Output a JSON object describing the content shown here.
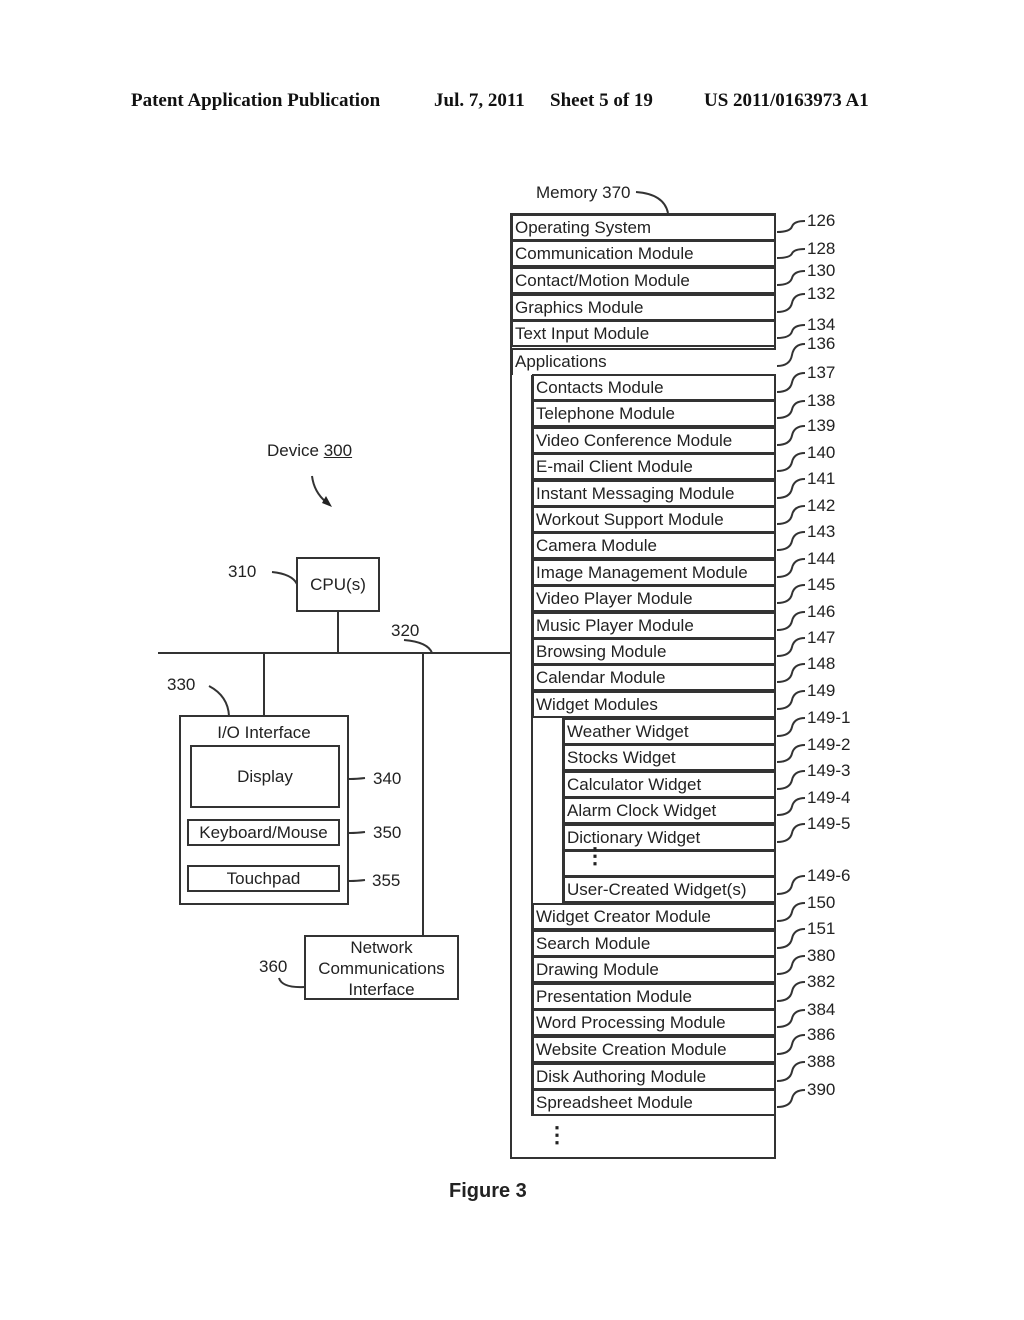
{
  "header": {
    "publication": "Patent Application Publication",
    "date": "Jul. 7, 2011",
    "sheet": "Sheet 5 of 19",
    "number": "US 2011/0163973 A1"
  },
  "device": {
    "label": "Device",
    "ref": "300"
  },
  "cpu": {
    "label": "CPU(s)",
    "ref": "310"
  },
  "bus": {
    "ref": "320"
  },
  "io": {
    "label": "I/O Interface",
    "ref": "330",
    "display": {
      "label": "Display",
      "ref": "340"
    },
    "keyboard": {
      "label": "Keyboard/Mouse",
      "ref": "350"
    },
    "touchpad": {
      "label": "Touchpad",
      "ref": "355"
    }
  },
  "network": {
    "line1": "Network",
    "line2": "Communications",
    "line3": "Interface",
    "ref": "360"
  },
  "memory": {
    "label": "Memory 370",
    "top_items": [
      {
        "label": "Operating System",
        "ref": "126"
      },
      {
        "label": "Communication Module",
        "ref": "128"
      },
      {
        "label": "Contact/Motion Module",
        "ref": "130"
      },
      {
        "label": "Graphics Module",
        "ref": "132"
      },
      {
        "label": "Text Input Module",
        "ref": "134"
      },
      {
        "label": "Applications",
        "ref": "136"
      }
    ],
    "applications": [
      {
        "label": "Contacts Module",
        "ref": "137"
      },
      {
        "label": "Telephone Module",
        "ref": "138"
      },
      {
        "label": "Video Conference Module",
        "ref": "139"
      },
      {
        "label": "E-mail Client Module",
        "ref": "140"
      },
      {
        "label": "Instant Messaging Module",
        "ref": "141"
      },
      {
        "label": "Workout Support Module",
        "ref": "142"
      },
      {
        "label": "Camera Module",
        "ref": "143"
      },
      {
        "label": "Image Management Module",
        "ref": "144"
      },
      {
        "label": "Video Player Module",
        "ref": "145"
      },
      {
        "label": "Music Player Module",
        "ref": "146"
      },
      {
        "label": "Browsing Module",
        "ref": "147"
      },
      {
        "label": "Calendar Module",
        "ref": "148"
      },
      {
        "label": "Widget Modules",
        "ref": "149"
      }
    ],
    "widgets": [
      {
        "label": "Weather Widget",
        "ref": "149-1"
      },
      {
        "label": "Stocks Widget",
        "ref": "149-2"
      },
      {
        "label": "Calculator Widget",
        "ref": "149-3"
      },
      {
        "label": "Alarm Clock Widget",
        "ref": "149-4"
      },
      {
        "label": "Dictionary Widget",
        "ref": "149-5"
      },
      {
        "label": "",
        "ref": ""
      },
      {
        "label": "User-Created Widget(s)",
        "ref": "149-6"
      }
    ],
    "more_apps": [
      {
        "label": "Widget Creator Module",
        "ref": "150"
      },
      {
        "label": "Search Module",
        "ref": "151"
      },
      {
        "label": "Drawing Module",
        "ref": "380"
      },
      {
        "label": "Presentation Module",
        "ref": "382"
      },
      {
        "label": "Word Processing  Module",
        "ref": "384"
      },
      {
        "label": "Website Creation Module",
        "ref": "386"
      },
      {
        "label": "Disk Authoring Module",
        "ref": "388"
      },
      {
        "label": "Spreadsheet Module",
        "ref": "390"
      }
    ]
  },
  "figure": {
    "caption": "Figure 3"
  }
}
